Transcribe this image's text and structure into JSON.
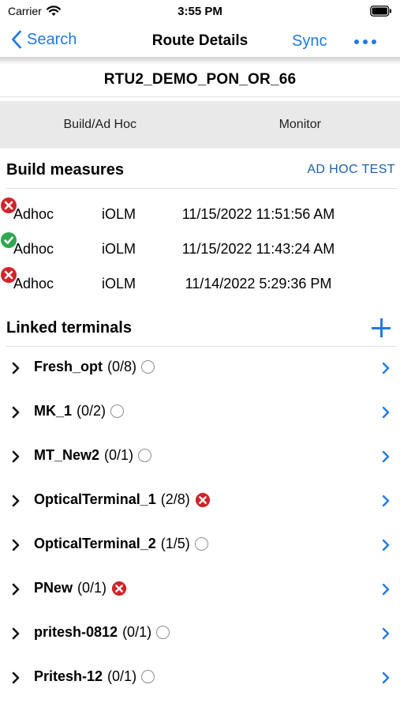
{
  "status_bar": {
    "carrier": "Carrier",
    "time": "3:55 PM"
  },
  "nav": {
    "back_label": "Search",
    "title": "Route Details",
    "sync_label": "Sync"
  },
  "route": {
    "name": "RTU2_DEMO_PON_OR_66"
  },
  "tabs": [
    {
      "label": "Build/Ad Hoc"
    },
    {
      "label": "Monitor"
    }
  ],
  "build_measures": {
    "heading": "Build measures",
    "action_label": "AD HOC TEST",
    "rows": [
      {
        "type": "Adhoc",
        "tool": "iOLM",
        "datetime": "11/15/2022 11:51:56 AM",
        "status": "fail"
      },
      {
        "type": "Adhoc",
        "tool": "iOLM",
        "datetime": "11/15/2022 11:43:24 AM",
        "status": "pass"
      },
      {
        "type": "Adhoc",
        "tool": "iOLM",
        "datetime": "11/14/2022 5:29:36 PM",
        "status": "fail"
      }
    ]
  },
  "linked_terminals": {
    "heading": "Linked terminals",
    "items": [
      {
        "name": "Fresh_opt",
        "count": "(0/8)",
        "status": "none"
      },
      {
        "name": "MK_1",
        "count": "(0/2)",
        "status": "none"
      },
      {
        "name": "MT_New2",
        "count": "(0/1)",
        "status": "none"
      },
      {
        "name": "OpticalTerminal_1",
        "count": "(2/8)",
        "status": "fail"
      },
      {
        "name": "OpticalTerminal_2",
        "count": "(1/5)",
        "status": "none"
      },
      {
        "name": "PNew",
        "count": "(0/1)",
        "status": "fail"
      },
      {
        "name": "pritesh-0812",
        "count": "(0/1)",
        "status": "none"
      },
      {
        "name": "Pritesh-12",
        "count": "(0/1)",
        "status": "none"
      }
    ]
  },
  "colors": {
    "accent": "#1f7ae0",
    "fail": "#d0242b",
    "pass": "#2fa84f",
    "tab_bar": "#e9e9e9"
  }
}
